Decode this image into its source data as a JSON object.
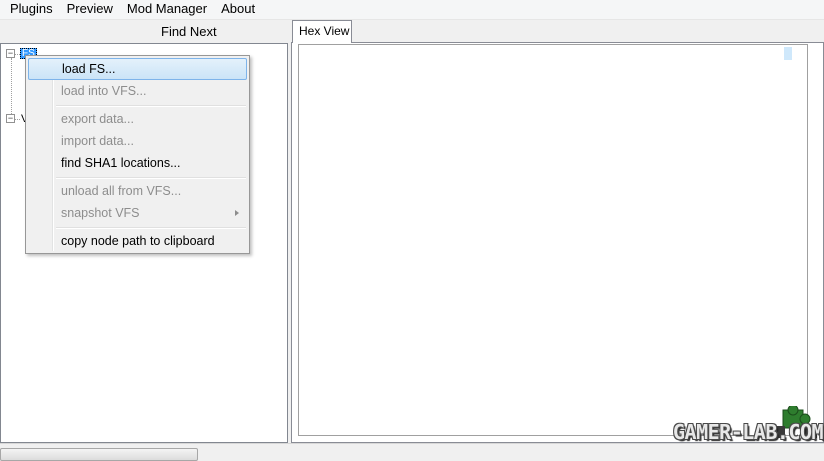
{
  "menubar": {
    "items": [
      "Plugins",
      "Preview",
      "Mod Manager",
      "About"
    ]
  },
  "toolbar": {
    "find_next_label": "Find Next"
  },
  "tree": {
    "nodes": [
      {
        "label": "FS",
        "expander": "⊟",
        "selected": true
      },
      {
        "label": "V",
        "expander": "⊟",
        "selected": false
      }
    ]
  },
  "context_menu": {
    "items": [
      {
        "label": "load FS...",
        "enabled": true,
        "highlighted": true
      },
      {
        "label": "load into VFS...",
        "enabled": false
      },
      {
        "label": "export data...",
        "enabled": false
      },
      {
        "label": "import data...",
        "enabled": false
      },
      {
        "label": "find SHA1 locations...",
        "enabled": true
      },
      {
        "label": "unload all from VFS...",
        "enabled": false
      },
      {
        "label": "snapshot VFS",
        "enabled": false,
        "submenu": true
      },
      {
        "label": "copy node path to clipboard",
        "enabled": true
      }
    ]
  },
  "tabs": [
    {
      "label": "Hex View",
      "active": true
    }
  ],
  "watermark": {
    "text": "GAMER-LAB.COM"
  },
  "colors": {
    "selection": "#3399ff",
    "menu_highlight_border": "#7eb4ea",
    "disabled_text": "#8d8d8d",
    "watermark_green": "#2e7d2e"
  }
}
